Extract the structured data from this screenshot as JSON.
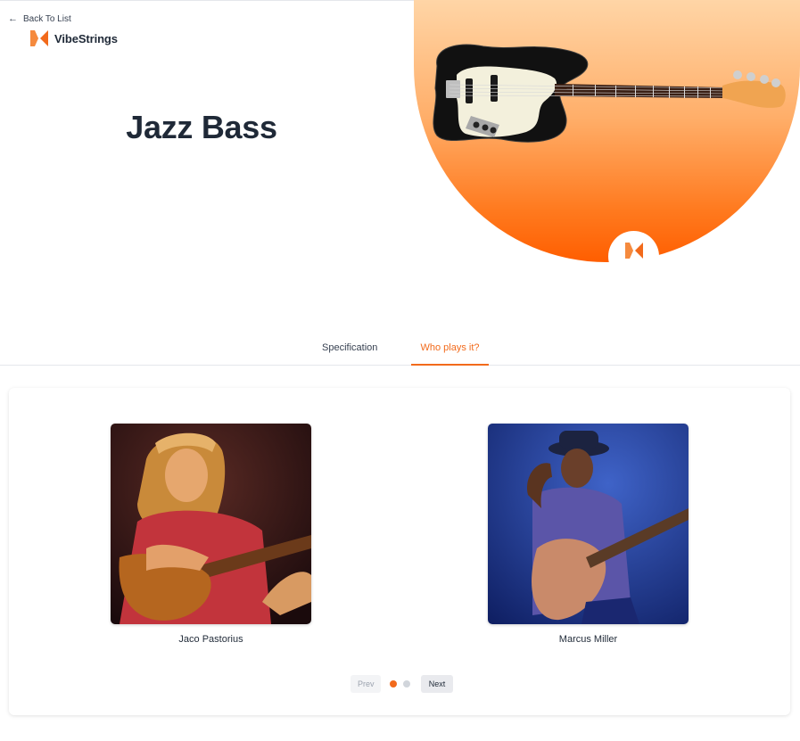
{
  "header": {
    "back_label": "Back To List",
    "brand_name": "VibeStrings"
  },
  "product": {
    "title": "Jazz Bass"
  },
  "tabs": [
    {
      "label": "Specification",
      "active": false
    },
    {
      "label": "Who plays it?",
      "active": true
    }
  ],
  "players": [
    {
      "name": "Jaco Pastorius"
    },
    {
      "name": "Marcus Miller"
    }
  ],
  "pagination": {
    "prev_label": "Prev",
    "next_label": "Next",
    "pages": 2,
    "current": 1
  },
  "colors": {
    "accent": "#f26a1b",
    "text": "#1f2937"
  }
}
